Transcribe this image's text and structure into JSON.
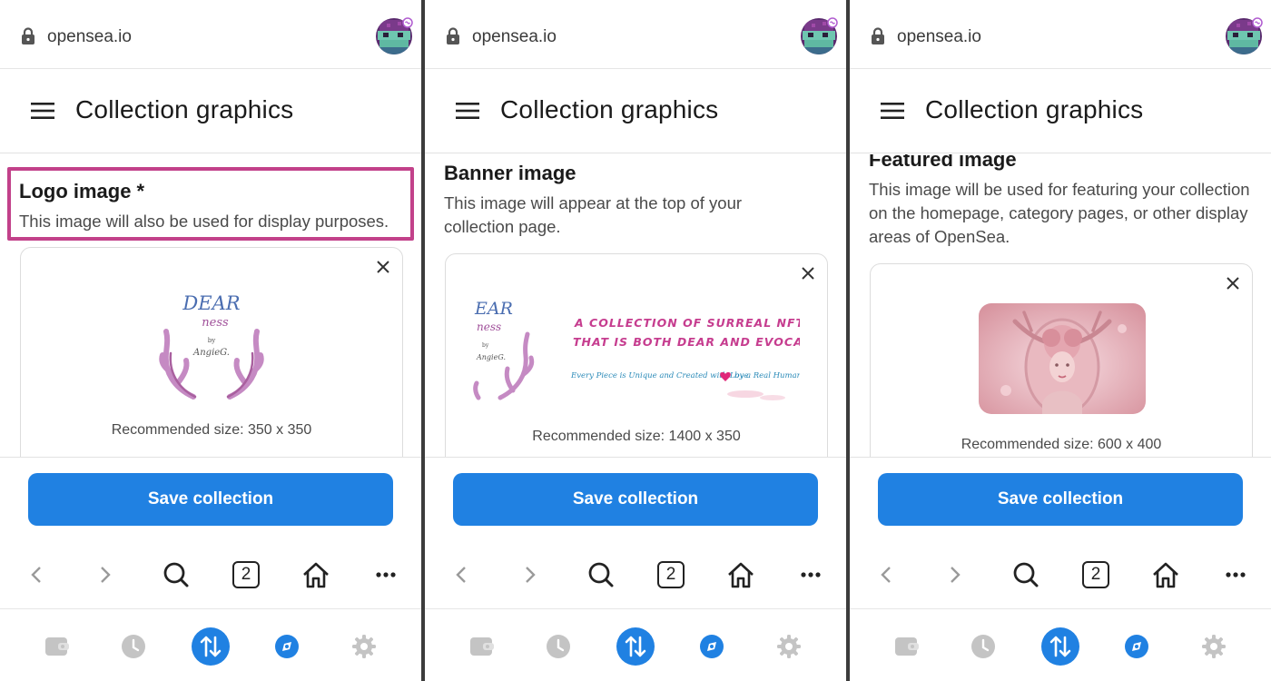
{
  "browser": {
    "url": "opensea.io",
    "tab_count": "2"
  },
  "page": {
    "title": "Collection graphics"
  },
  "colors": {
    "accent": "#2081e2",
    "highlight": "#c2418a",
    "brand_pink": "#c63d8f"
  },
  "screens": [
    {
      "section_title": "Logo image *",
      "section_desc": "This image will also be used for display purposes.",
      "recommended": "Recommended size: 350 x 350",
      "logo": {
        "line1": "DEAR",
        "line2": "ness",
        "by": "by",
        "sig": "AngieG."
      }
    },
    {
      "section_title": "Banner image",
      "section_desc": "This image will appear at the top of your collection page.",
      "recommended": "Recommended size: 1400 x 350",
      "logo": {
        "line1": "EAR",
        "line2": "ness",
        "by": "by",
        "sig": "AngieG."
      },
      "banner": {
        "line1": "A COLLECTION OF SURREAL NFT A",
        "line2": "THAT IS BOTH DEAR AND EVOCATI",
        "line3": "Every Piece is Unique and Created with Love",
        "line4": "by a Real Human A"
      }
    },
    {
      "section_title": "Featured image",
      "section_desc": "This image will be used for featuring your collection on the homepage, category pages, or other display areas of OpenSea.",
      "recommended": "Recommended size: 600 x 400"
    }
  ],
  "actions": {
    "save_label": "Save collection"
  },
  "icons": {
    "urlbar": [
      "lock-icon",
      "avatar-icon"
    ],
    "header": [
      "menu-icon"
    ],
    "card": [
      "close-icon"
    ],
    "browser_nav": [
      "back-icon",
      "forward-icon",
      "search-icon",
      "tabs-icon",
      "home-icon",
      "more-icon"
    ],
    "bottom_bar": [
      "wallet-icon",
      "history-icon",
      "swap-icon",
      "explore-icon",
      "settings-icon"
    ]
  }
}
